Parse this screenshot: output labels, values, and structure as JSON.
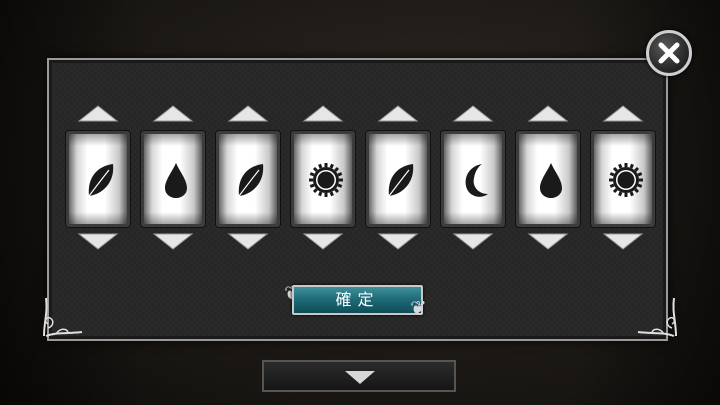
{
  "confirm_label": "確定",
  "reels": [
    {
      "symbol": "leaf-icon"
    },
    {
      "symbol": "water-drop-icon"
    },
    {
      "symbol": "leaf-icon"
    },
    {
      "symbol": "sun-icon"
    },
    {
      "symbol": "leaf-icon"
    },
    {
      "symbol": "moon-icon"
    },
    {
      "symbol": "water-drop-icon"
    },
    {
      "symbol": "sun-icon"
    }
  ],
  "colors": {
    "confirm_bg": "#1d6976",
    "tile_bg": "#ffffff",
    "icon": "#1a1a1a"
  }
}
